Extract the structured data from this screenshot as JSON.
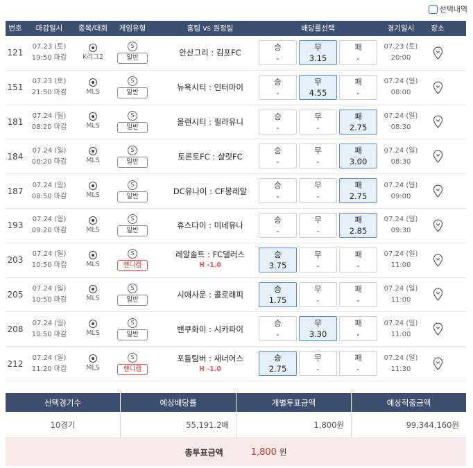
{
  "selection": {
    "label": "선택내역"
  },
  "header": {
    "num": "번호",
    "deadline": "마감일시",
    "league": "종목/대회",
    "game_type": "게임유형",
    "teams": "홈팀 vs 원정팀",
    "odds": "배당률선택",
    "game_time": "경기일시",
    "location": "장소"
  },
  "odds_labels": {
    "win": "승",
    "draw": "무",
    "lose": "패"
  },
  "game_icon_text": "S",
  "rows": [
    {
      "num": "121",
      "d1": "07.23 (토)",
      "d2": "19:50 마감",
      "league": "K리그2",
      "type": "일반",
      "handicap": false,
      "hcap": "",
      "home": "안산그리",
      "away": "김포FC",
      "win": "-",
      "draw": "3.15",
      "lose": "-",
      "selected": "draw",
      "g1": "07.23 (토)",
      "g2": "20:00"
    },
    {
      "num": "151",
      "d1": "07.23 (토)",
      "d2": "21:50 마감",
      "league": "MLS",
      "type": "일반",
      "handicap": false,
      "hcap": "",
      "home": "뉴욕시티",
      "away": "인터마이",
      "win": "-",
      "draw": "4.55",
      "lose": "-",
      "selected": "draw",
      "g1": "07.24 (일)",
      "g2": "08:00"
    },
    {
      "num": "181",
      "d1": "07.24 (일)",
      "d2": "08:20 마감",
      "league": "MLS",
      "type": "일반",
      "handicap": false,
      "hcap": "",
      "home": "올랜시티",
      "away": "필라유니",
      "win": "-",
      "draw": "-",
      "lose": "2.75",
      "selected": "lose",
      "g1": "07.24 (일)",
      "g2": "08:30"
    },
    {
      "num": "184",
      "d1": "07.24 (일)",
      "d2": "08:20 마감",
      "league": "MLS",
      "type": "일반",
      "handicap": false,
      "hcap": "",
      "home": "토론토FC",
      "away": "샬럿FC",
      "win": "-",
      "draw": "-",
      "lose": "3.00",
      "selected": "lose",
      "g1": "07.24 (일)",
      "g2": "08:30"
    },
    {
      "num": "187",
      "d1": "07.24 (일)",
      "d2": "08:50 마감",
      "league": "MLS",
      "type": "일반",
      "handicap": false,
      "hcap": "",
      "home": "DC유나이",
      "away": "CF몽레알",
      "win": "-",
      "draw": "-",
      "lose": "2.75",
      "selected": "lose",
      "g1": "07.24 (일)",
      "g2": "09:00"
    },
    {
      "num": "193",
      "d1": "07.24 (일)",
      "d2": "09:20 마감",
      "league": "MLS",
      "type": "일반",
      "handicap": false,
      "hcap": "",
      "home": "휴스다이",
      "away": "미네유나",
      "win": "-",
      "draw": "-",
      "lose": "2.85",
      "selected": "lose",
      "g1": "07.24 (일)",
      "g2": "09:30"
    },
    {
      "num": "203",
      "d1": "07.24 (일)",
      "d2": "10:50 마감",
      "league": "MLS",
      "type": "핸디캡",
      "handicap": true,
      "hcap": "H -1.0",
      "home": "레알솔트",
      "away": "FC댈러스",
      "win": "3.75",
      "draw": "-",
      "lose": "-",
      "selected": "win",
      "g1": "07.24 (일)",
      "g2": "11:00"
    },
    {
      "num": "205",
      "d1": "07.24 (일)",
      "d2": "10:50 마감",
      "league": "MLS",
      "type": "일반",
      "handicap": false,
      "hcap": "",
      "home": "시애사운",
      "away": "콜로래피",
      "win": "1.75",
      "draw": "-",
      "lose": "-",
      "selected": "win",
      "g1": "07.24 (일)",
      "g2": "11:00"
    },
    {
      "num": "208",
      "d1": "07.24 (일)",
      "d2": "10:50 마감",
      "league": "MLS",
      "type": "일반",
      "handicap": false,
      "hcap": "",
      "home": "밴쿠화이",
      "away": "시카파이",
      "win": "-",
      "draw": "3.30",
      "lose": "-",
      "selected": "draw",
      "g1": "07.24 (일)",
      "g2": "11:00"
    },
    {
      "num": "212",
      "d1": "07.24 (일)",
      "d2": "11:20 마감",
      "league": "MLS",
      "type": "핸디캡",
      "handicap": true,
      "hcap": "H -1.0",
      "home": "포틀팀버",
      "away": "새너어스",
      "win": "2.75",
      "draw": "-",
      "lose": "-",
      "selected": "win",
      "g1": "07.24 (일)",
      "g2": "11:30"
    }
  ],
  "summary": {
    "headers": [
      "선택경기수",
      "예상배당률",
      "개별투표금액",
      "예상적중금액"
    ],
    "values": [
      "10경기",
      "55,191.2배",
      "1,800원",
      "99,344,160원"
    ],
    "total_label": "총투표금액",
    "total_value": "1,800",
    "total_unit": "원"
  },
  "colors": {
    "header_bg": "#3d4f6f",
    "selected_bg": "#e5f0fb",
    "total_bg": "#fbeaea",
    "handicap": "#e55555"
  }
}
